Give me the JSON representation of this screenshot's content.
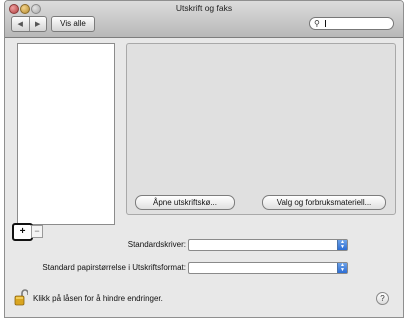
{
  "window": {
    "title": "Utskrift og faks"
  },
  "toolbar": {
    "back_label": "◀",
    "forward_label": "▶",
    "show_all_label": "Vis alle",
    "search_placeholder": ""
  },
  "detail": {
    "open_queue_label": "Åpne utskriftskø...",
    "options_supplies_label": "Valg og forbruksmateriell..."
  },
  "list_controls": {
    "add_label": "+",
    "remove_label": "−"
  },
  "settings": {
    "default_printer_label": "Standardskriver:",
    "default_printer_value": "",
    "default_paper_label": "Standard papirstørrelse i Utskriftsformat:",
    "default_paper_value": ""
  },
  "footer": {
    "lock_message": "Klikk på låsen for å hindre endringer.",
    "help_label": "?"
  }
}
